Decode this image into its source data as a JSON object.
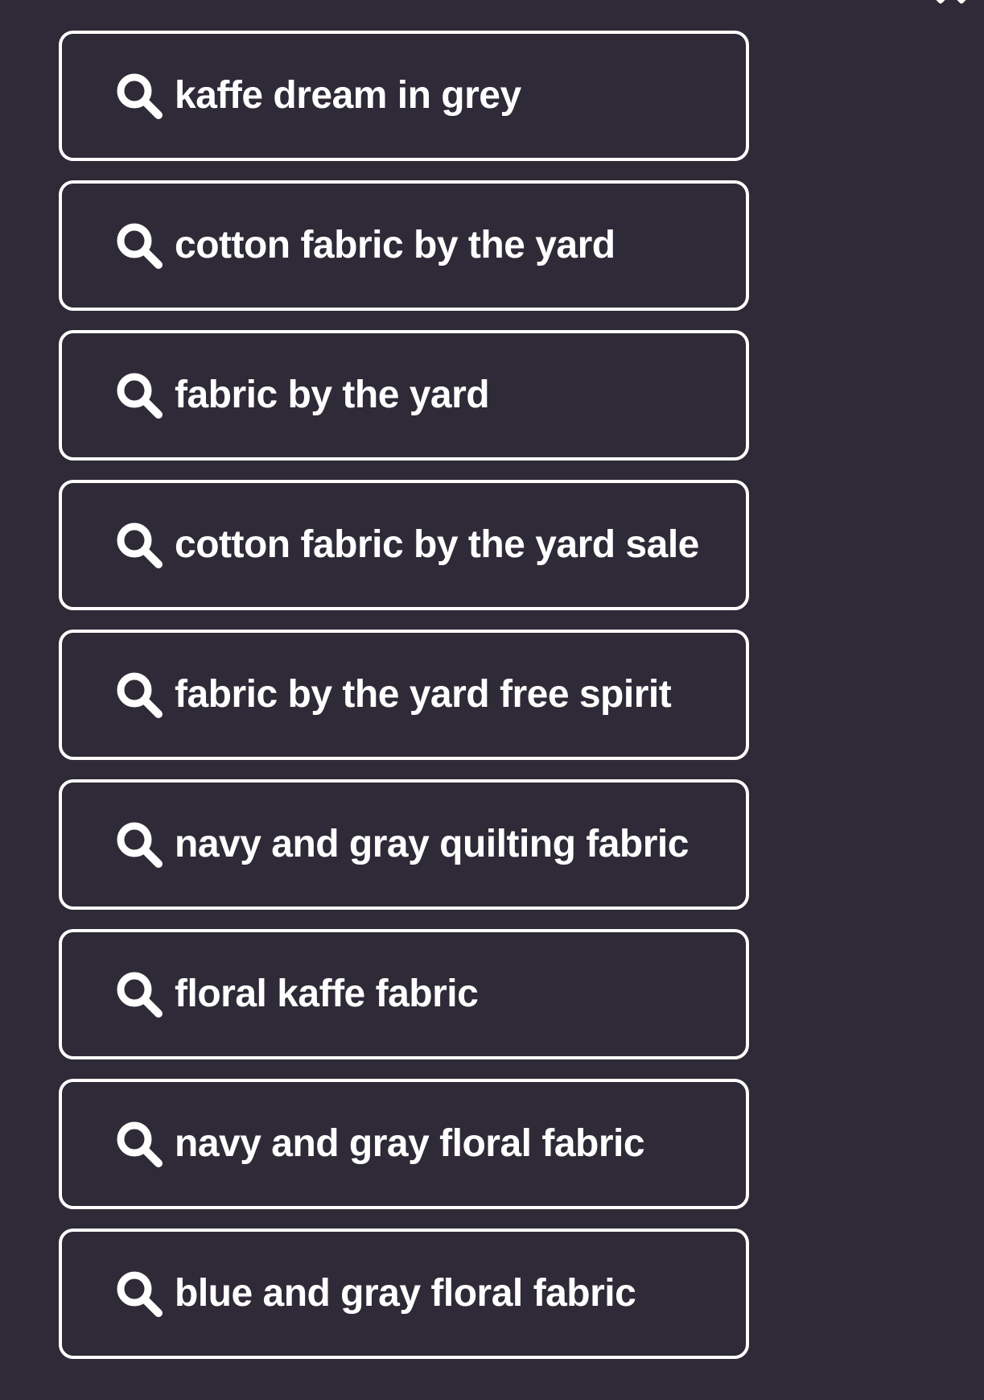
{
  "header": {
    "corner_icon": "chevron-icon"
  },
  "suggestions": [
    {
      "label": "kaffe dream in grey",
      "icon": "search-icon"
    },
    {
      "label": "cotton fabric by the yard",
      "icon": "search-icon"
    },
    {
      "label": "fabric by the yard",
      "icon": "search-icon"
    },
    {
      "label": "cotton fabric by the yard sale",
      "icon": "search-icon"
    },
    {
      "label": "fabric by the yard free spirit",
      "icon": "search-icon"
    },
    {
      "label": "navy and gray quilting fabric",
      "icon": "search-icon"
    },
    {
      "label": "floral kaffe fabric",
      "icon": "search-icon"
    },
    {
      "label": "navy and gray floral fabric",
      "icon": "search-icon"
    },
    {
      "label": "blue and gray floral fabric",
      "icon": "search-icon"
    }
  ],
  "colors": {
    "background": "#2f2a37",
    "chip_border": "#ffffff",
    "text": "#ffffff"
  }
}
